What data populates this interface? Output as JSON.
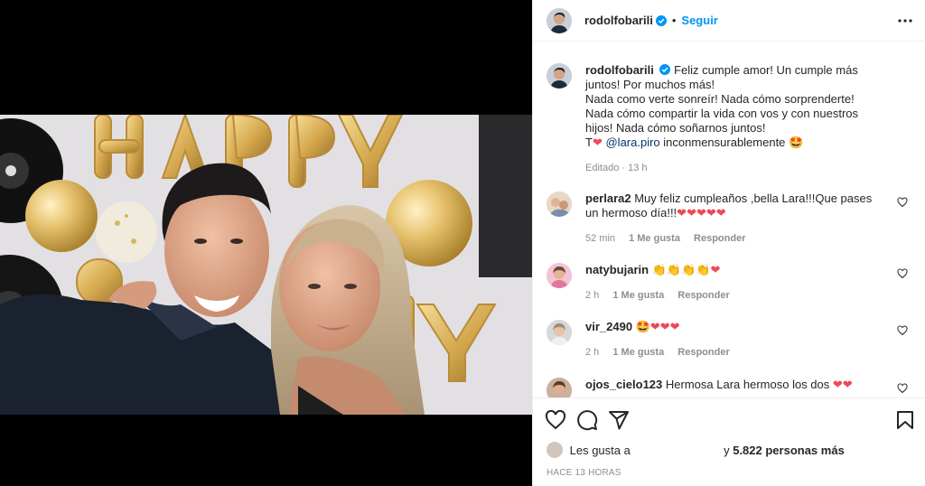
{
  "header": {
    "username": "rodolfobarili",
    "separator": "•",
    "follow_label": "Seguir"
  },
  "caption": {
    "username": "rodolfobarili",
    "text_1": "Feliz cumple amor! Un cumple más juntos! Por muchos más!",
    "text_2": "Nada como verte sonreír! Nada cómo sorprenderte! Nada cómo compartir la vida con vos y con nuestros hijos! Nada cómo soñarnos juntos!",
    "text_3_prefix": "T",
    "mention": "@lara.piro",
    "text_3_suffix": "inconmensurablemente",
    "edited": "Editado",
    "time": "13 h"
  },
  "comments": [
    {
      "username": "perlara2",
      "text": "Muy feliz cumpleaños ,bella Lara!!!Que pases un hermoso día!!!",
      "hearts": "❤❤❤❤❤",
      "time": "52 min",
      "likes": "1 Me gusta",
      "reply": "Responder"
    },
    {
      "username": "natybujarin",
      "text": "👏👏👏👏",
      "hearts": "❤",
      "time": "2 h",
      "likes": "1 Me gusta",
      "reply": "Responder"
    },
    {
      "username": "vir_2490",
      "text": "🤩",
      "hearts": "❤❤❤",
      "time": "2 h",
      "likes": "1 Me gusta",
      "reply": "Responder"
    },
    {
      "username": "ojos_cielo123",
      "text": "Hermosa Lara hermoso los dos",
      "hearts": "❤❤",
      "time": "",
      "likes": "",
      "reply": ""
    }
  ],
  "likes": {
    "prefix": "Les gusta a",
    "suffix": "y",
    "count": "5.822 personas más"
  },
  "posted_ago": "HACE 13 HORAS",
  "colors": {
    "accent": "#0095f6",
    "heart": "#ed4956"
  }
}
